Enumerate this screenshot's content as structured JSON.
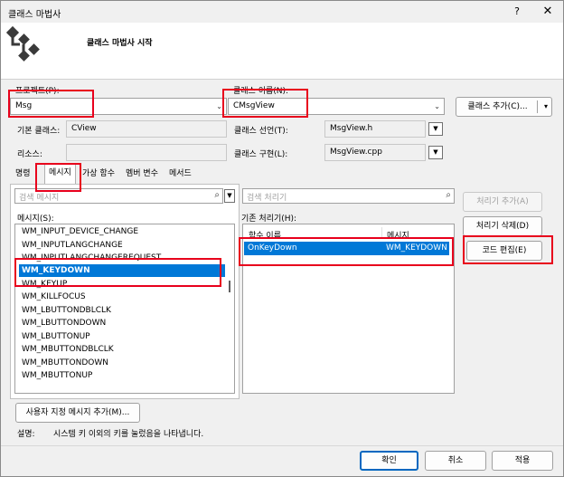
{
  "window": {
    "title": "클래스 마법사",
    "help": "?",
    "close": "✕"
  },
  "header": {
    "title": "클래스 마법사 시작"
  },
  "form": {
    "project_label": "프로젝트(P):",
    "project_value": "Msg",
    "class_name_label": "클래스 이름(N):",
    "class_name_value": "CMsgView",
    "add_class_label": "클래스 추가(C)...",
    "base_class_label": "기본 클래스:",
    "base_class_value": "CView",
    "class_decl_label": "클래스 선언(T):",
    "class_decl_value": "MsgView.h",
    "resource_label": "리소스:",
    "resource_value": "",
    "class_impl_label": "클래스 구현(L):",
    "class_impl_value": "MsgView.cpp"
  },
  "tabs": [
    {
      "label": "명령"
    },
    {
      "label": "메시지"
    },
    {
      "label": "가상 함수"
    },
    {
      "label": "멤버 변수"
    },
    {
      "label": "메서드"
    }
  ],
  "messages": {
    "search_placeholder": "검색 메시지",
    "label": "메시지(S):",
    "items": [
      "WM_INPUT_DEVICE_CHANGE",
      "WM_INPUTLANGCHANGE",
      "WM_INPUTLANGCHANGEREQUEST",
      "WM_KEYDOWN",
      "WM_KEYUP",
      "WM_KILLFOCUS",
      "WM_LBUTTONDBLCLK",
      "WM_LBUTTONDOWN",
      "WM_LBUTTONUP",
      "WM_MBUTTONDBLCLK",
      "WM_MBUTTONDOWN",
      "WM_MBUTTONUP"
    ],
    "selected_index": 3
  },
  "handlers": {
    "search_placeholder": "검색 처리기",
    "label": "기존 처리기(H):",
    "col_function": "함수 이름",
    "col_message": "메시지",
    "rows": [
      {
        "function": "OnKeyDown",
        "message": "WM_KEYDOWN"
      }
    ]
  },
  "side_buttons": {
    "add_handler": "처리기 추가(A)",
    "delete_handler": "처리기 삭제(D)",
    "edit_code": "코드 편집(E)"
  },
  "custom_message_button": "사용자 지정 메시지 추가(M)...",
  "description": {
    "label": "설명:",
    "text": "시스템 키 이외의 키를 눌렀음을 나타냅니다."
  },
  "footer": {
    "ok": "확인",
    "cancel": "취소",
    "apply": "적용"
  },
  "colors": {
    "selection": "#0078d7",
    "highlight_box": "#e8001c",
    "primary_border": "#0067c0"
  }
}
